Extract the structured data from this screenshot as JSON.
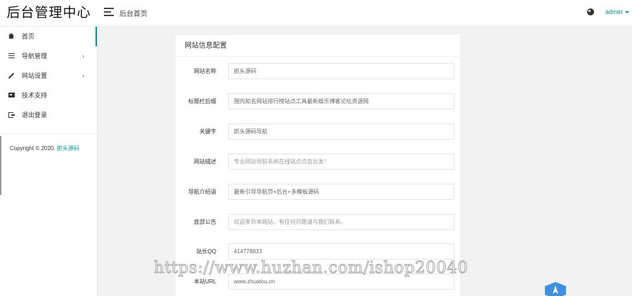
{
  "app": {
    "logo_text": "后台管理中心"
  },
  "header": {
    "breadcrumb": "后台首页",
    "user_name": "admin"
  },
  "sidebar": {
    "items": [
      {
        "label": "首页",
        "icon": "home-icon",
        "active": true
      },
      {
        "label": "导航管理",
        "icon": "list-icon",
        "has_submenu": true
      },
      {
        "label": "网站设置",
        "icon": "pen-icon",
        "has_submenu": true
      },
      {
        "label": "技术支持",
        "icon": "card-icon"
      },
      {
        "label": "退出登录",
        "icon": "exit-icon"
      }
    ],
    "chevron": "›",
    "copyright_prefix": "Copyright © 2020.",
    "copyright_link": "抓头源码"
  },
  "panel": {
    "title": "网站信息配置",
    "fields": [
      {
        "label": "网站名称",
        "value": "抓头源码",
        "placeholder": false
      },
      {
        "label": "标题栏后缀",
        "value": "国内知名网站排行榜站点工具最新娱乐博客论坛资源网",
        "placeholder": false
      },
      {
        "label": "关键字",
        "value": "抓头源码导航",
        "placeholder": false
      },
      {
        "label": "网站描述",
        "value": "专业网站导航系统在线站点点击出发！",
        "placeholder": true
      },
      {
        "label": "导航介绍语",
        "value": "最新引导导航页+后台+多模板源码",
        "placeholder": false
      },
      {
        "label": "底部公告",
        "value": "欢迎来到本网站，有任何问题请与我们联系。",
        "placeholder": true
      },
      {
        "label": "站长QQ",
        "value": "414778833",
        "placeholder": false
      },
      {
        "label": "本站URL",
        "value": "www.zhuatou.cn",
        "placeholder": false
      }
    ]
  },
  "watermark": "https://www.huzhan.com/ishop20040",
  "colors": {
    "accent": "#009688",
    "background": "#f2f2f2"
  }
}
